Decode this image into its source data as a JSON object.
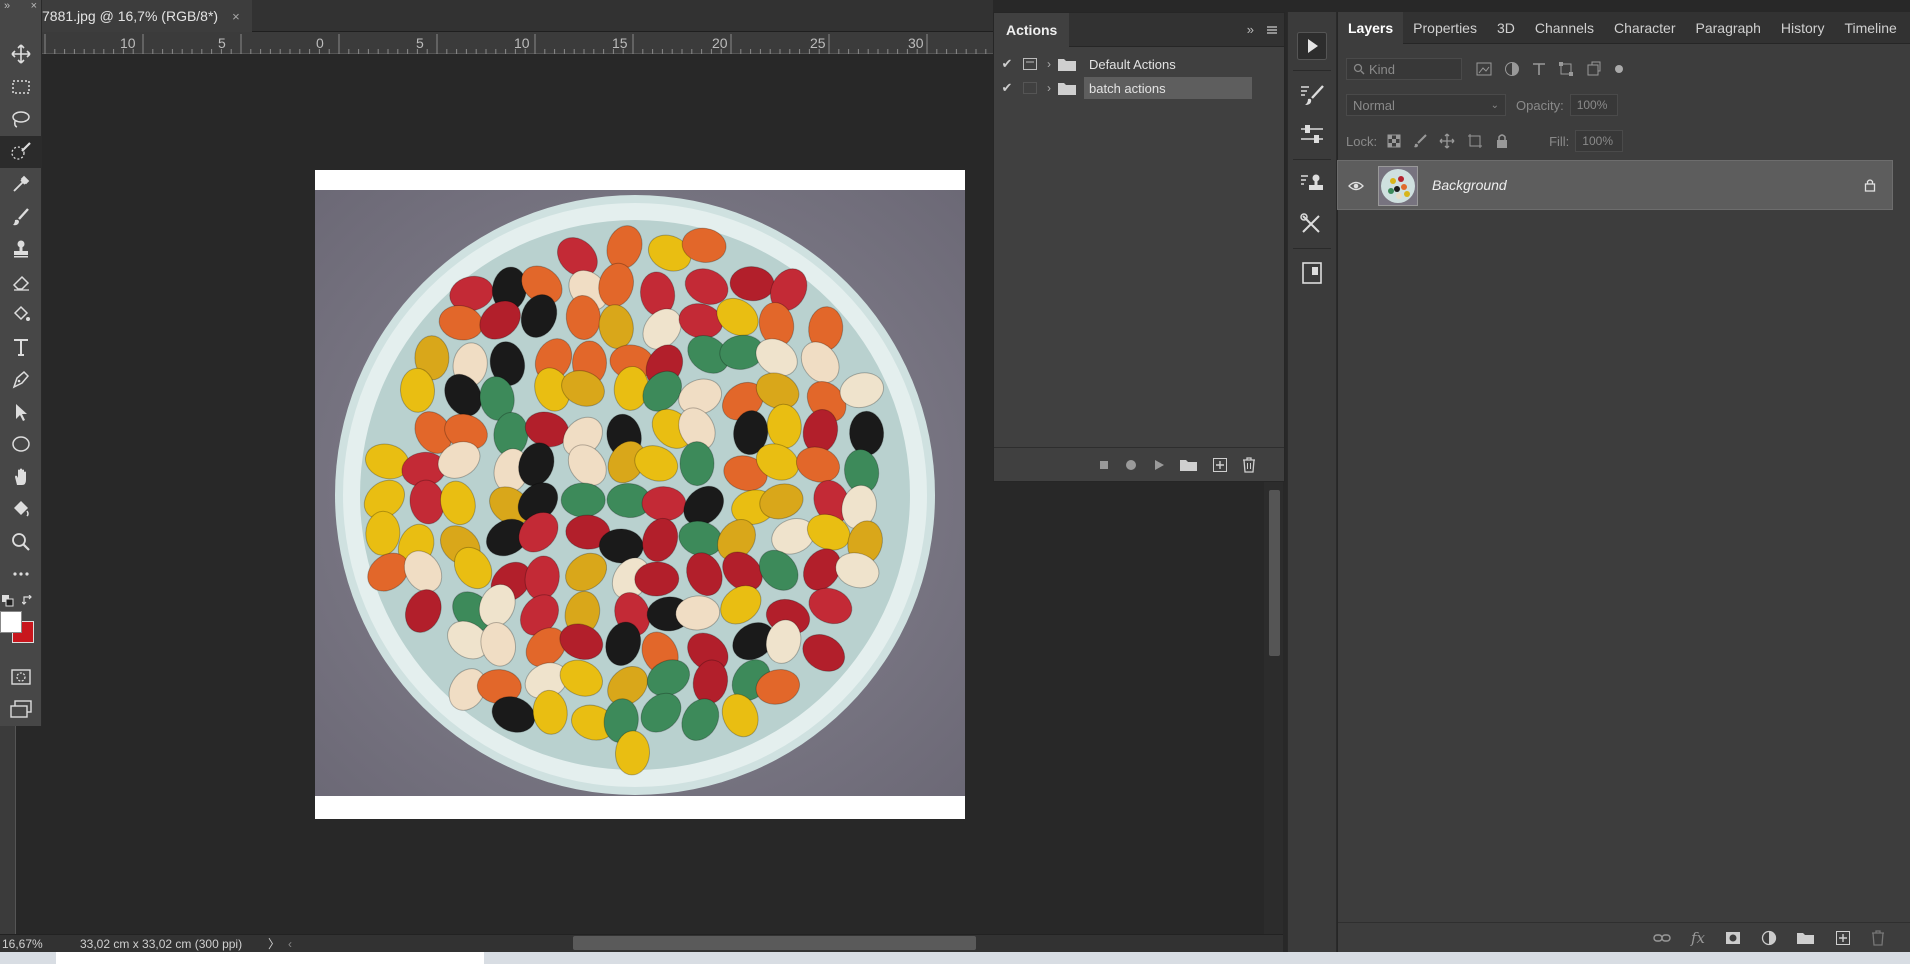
{
  "document": {
    "tab_title": "7881.jpg @ 16,7% (RGB/8*)",
    "close_glyph": "×"
  },
  "ruler": {
    "horizontal_labels": [
      "10",
      "5",
      "0",
      "5",
      "10",
      "15",
      "20",
      "25",
      "30"
    ]
  },
  "status_bar": {
    "zoom": "16,67%",
    "doc_info": "33,02 cm x 33,02 cm (300 ppi)",
    "arrow": "〉"
  },
  "toolbar": {
    "collapse_glyph": "»",
    "close_glyph": "×",
    "tools": [
      "move-icon",
      "marquee-icon",
      "lasso-icon",
      "quick-selection-icon",
      "eyedropper-icon",
      "brush-icon",
      "stamp-icon",
      "eraser-icon",
      "paint-bucket-icon",
      "type-icon",
      "pen-icon",
      "path-selection-icon",
      "ellipse-icon",
      "hand-icon",
      "fill-icon",
      "zoom-icon",
      "more-icon"
    ],
    "foreground_color": "#ffffff",
    "background_color": "#c8161d"
  },
  "actions_panel": {
    "tab_label": "Actions",
    "items": [
      {
        "label": "Default Actions",
        "checked": true
      },
      {
        "label": "batch actions",
        "checked": true
      }
    ],
    "footer_buttons": [
      "stop-icon",
      "record-icon",
      "play-icon",
      "new-set-icon",
      "new-action-icon",
      "delete-icon"
    ]
  },
  "dock": {
    "buttons": [
      "play-icon",
      "brush-settings-icon",
      "adjustments-icon",
      "clone-source-icon",
      "tools-icon",
      "notes-icon"
    ]
  },
  "layers_panel": {
    "tabs": [
      "Layers",
      "Properties",
      "3D",
      "Channels",
      "Character",
      "Paragraph",
      "History",
      "Timeline"
    ],
    "active_tab": "Layers",
    "filter_label": "Kind",
    "blend_mode": "Normal",
    "opacity_label": "Opacity:",
    "opacity_value": "100%",
    "lock_label": "Lock:",
    "fill_label": "Fill:",
    "fill_value": "100%",
    "layers": [
      {
        "name": "Background",
        "visible": true,
        "locked": true
      }
    ],
    "footer_buttons": [
      "link-icon",
      "fx-icon",
      "mask-icon",
      "adjustment-layer-icon",
      "group-icon",
      "new-layer-icon",
      "trash-icon"
    ]
  },
  "colors": {
    "app_bg": "#282828",
    "panel_bg": "#3d3d3d",
    "accent_red": "#c8161d"
  }
}
